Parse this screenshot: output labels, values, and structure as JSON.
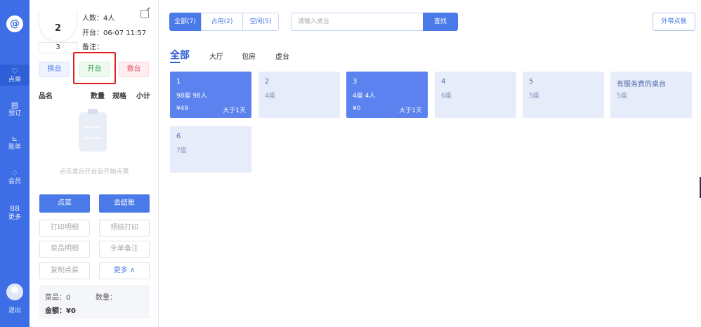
{
  "nav": {
    "logo": "@",
    "items": [
      {
        "icon": "♡",
        "label": "点单"
      },
      {
        "icon": "▤",
        "label": "预订"
      },
      {
        "icon": "⊾",
        "label": "账单"
      },
      {
        "icon": "♢",
        "label": "会员"
      },
      {
        "icon": "88",
        "label": "更多"
      }
    ],
    "logout": "退出"
  },
  "panel": {
    "table_no": "2",
    "table_sub": "3",
    "people": "人数：4人",
    "open_time": "开台：06-07 11:57",
    "note": "备注：",
    "swap_btn": "换台",
    "open_btn": "开台",
    "cancel_btn": "撤台",
    "headers": {
      "name": "品名",
      "qty": "数量",
      "spec": "规格",
      "subtotal": "小计"
    },
    "empty_hint": "点击桌台开台后开始点菜",
    "order_btn": "点菜",
    "checkout_btn": "去结账",
    "print_detail": "打印明细",
    "pre_print": "预结打印",
    "dish_detail": "菜品明细",
    "whole_note": "全单备注",
    "copy_order": "复制点菜",
    "more": "更多 ∧",
    "dishes": "菜品：0",
    "count": "数量：",
    "amount": "金额：¥0"
  },
  "main": {
    "filters": [
      "全部(7)",
      "占用(2)",
      "空闲(5)"
    ],
    "search_placeholder": "请输入桌台",
    "search_btn": "查找",
    "takeout": "外带点餐",
    "areas": [
      "全部",
      "大厅",
      "包房",
      "虚台"
    ],
    "tables": [
      {
        "name": "1",
        "seats": "98座  98人",
        "price": "¥49",
        "time": "大于1天",
        "busy": true
      },
      {
        "name": "2",
        "seats": "4座",
        "busy": false
      },
      {
        "name": "3",
        "seats": "4座  4人",
        "price": "¥0",
        "time": "大于1天",
        "busy": true
      },
      {
        "name": "4",
        "seats": "6座",
        "busy": false
      },
      {
        "name": "5",
        "seats": "5座",
        "busy": false
      },
      {
        "name": "有服务费的桌台",
        "seats": "5座",
        "busy": false
      },
      {
        "name": "6",
        "seats": "7座",
        "busy": false
      }
    ]
  },
  "colors": {
    "primary": "#4a7ae8",
    "nav": "#3d6ee6",
    "highlight": "#e02020"
  }
}
